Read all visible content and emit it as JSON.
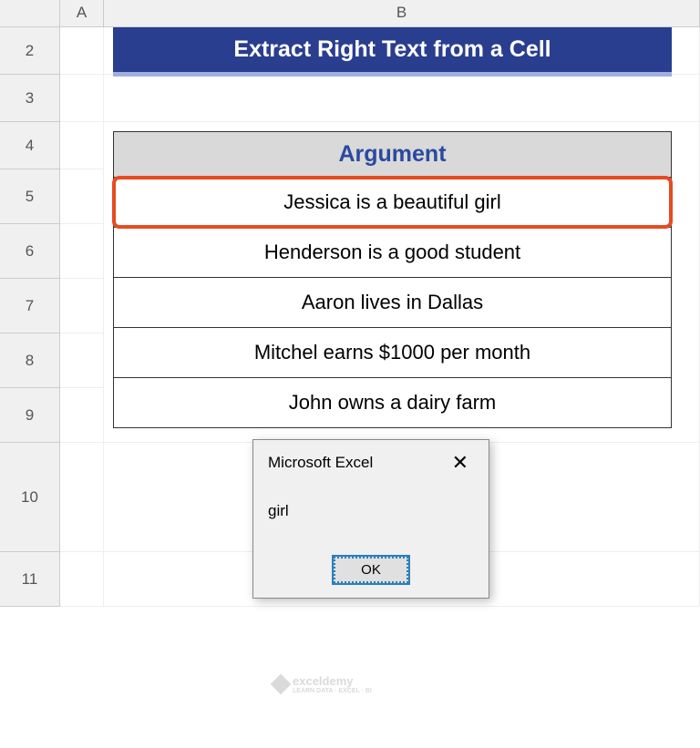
{
  "columns": {
    "a": "A",
    "b": "B"
  },
  "rows": [
    "2",
    "3",
    "4",
    "5",
    "6",
    "7",
    "8",
    "9",
    "10",
    "11"
  ],
  "banner": {
    "title": "Extract Right Text from a Cell"
  },
  "table": {
    "header": "Argument",
    "items": [
      "Jessica is a beautiful girl",
      "Henderson is a good student",
      "Aaron lives in Dallas",
      "Mitchel earns $1000 per month",
      "John owns a dairy farm"
    ]
  },
  "dialog": {
    "title": "Microsoft Excel",
    "close": "✕",
    "message": "girl",
    "ok": "OK"
  },
  "watermark": {
    "text": "exceldemy",
    "tagline": "LEARN DATA · EXCEL · BI"
  }
}
